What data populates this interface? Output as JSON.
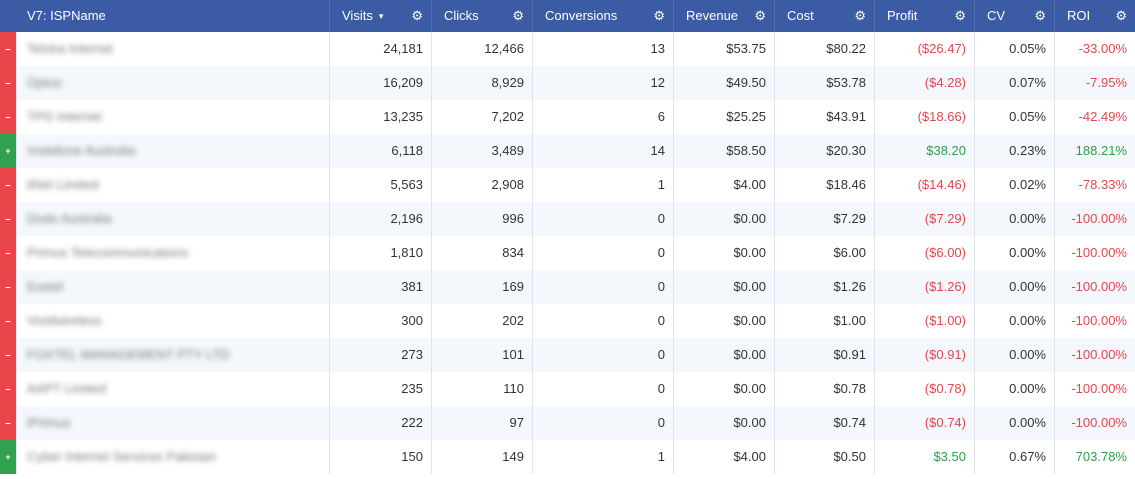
{
  "colors": {
    "header_bg": "#3b5ba5",
    "negative": "#e0484c",
    "positive": "#2e9e48",
    "indicator_minus": "#e9464b",
    "indicator_plus": "#2fa14f"
  },
  "header": {
    "name": "V7: ISPName",
    "visits": "Visits",
    "visits_sort": "▾",
    "clicks": "Clicks",
    "conversions": "Conversions",
    "revenue": "Revenue",
    "cost": "Cost",
    "profit": "Profit",
    "cv": "CV",
    "roi": "ROI",
    "gear": "⚙"
  },
  "rows": [
    {
      "ind": "–",
      "ind_type": "minus",
      "name": "Telstra Internet",
      "visits": "24,181",
      "clicks": "12,466",
      "conversions": "13",
      "revenue": "$53.75",
      "cost": "$80.22",
      "profit": "($26.47)",
      "cv": "0.05%",
      "roi": "-33.00%",
      "tone": "neg"
    },
    {
      "ind": "–",
      "ind_type": "minus",
      "name": "Optus",
      "visits": "16,209",
      "clicks": "8,929",
      "conversions": "12",
      "revenue": "$49.50",
      "cost": "$53.78",
      "profit": "($4.28)",
      "cv": "0.07%",
      "roi": "-7.95%",
      "tone": "neg"
    },
    {
      "ind": "–",
      "ind_type": "minus",
      "name": "TPG Internet",
      "visits": "13,235",
      "clicks": "7,202",
      "conversions": "6",
      "revenue": "$25.25",
      "cost": "$43.91",
      "profit": "($18.66)",
      "cv": "0.05%",
      "roi": "-42.49%",
      "tone": "neg"
    },
    {
      "ind": "+",
      "ind_type": "plus",
      "name": "Vodafone Australia",
      "visits": "6,118",
      "clicks": "3,489",
      "conversions": "14",
      "revenue": "$58.50",
      "cost": "$20.30",
      "profit": "$38.20",
      "cv": "0.23%",
      "roi": "188.21%",
      "tone": "pos"
    },
    {
      "ind": "–",
      "ind_type": "minus",
      "name": "iiNet Limited",
      "visits": "5,563",
      "clicks": "2,908",
      "conversions": "1",
      "revenue": "$4.00",
      "cost": "$18.46",
      "profit": "($14.46)",
      "cv": "0.02%",
      "roi": "-78.33%",
      "tone": "neg"
    },
    {
      "ind": "–",
      "ind_type": "minus",
      "name": "Dodo Australia",
      "visits": "2,196",
      "clicks": "996",
      "conversions": "0",
      "revenue": "$0.00",
      "cost": "$7.29",
      "profit": "($7.29)",
      "cv": "0.00%",
      "roi": "-100.00%",
      "tone": "neg"
    },
    {
      "ind": "–",
      "ind_type": "minus",
      "name": "Primus Telecommunications",
      "visits": "1,810",
      "clicks": "834",
      "conversions": "0",
      "revenue": "$0.00",
      "cost": "$6.00",
      "profit": "($6.00)",
      "cv": "0.00%",
      "roi": "-100.00%",
      "tone": "neg"
    },
    {
      "ind": "–",
      "ind_type": "minus",
      "name": "Exetel",
      "visits": "381",
      "clicks": "169",
      "conversions": "0",
      "revenue": "$0.00",
      "cost": "$1.26",
      "profit": "($1.26)",
      "cv": "0.00%",
      "roi": "-100.00%",
      "tone": "neg"
    },
    {
      "ind": "–",
      "ind_type": "minus",
      "name": "Vividwireless",
      "visits": "300",
      "clicks": "202",
      "conversions": "0",
      "revenue": "$0.00",
      "cost": "$1.00",
      "profit": "($1.00)",
      "cv": "0.00%",
      "roi": "-100.00%",
      "tone": "neg"
    },
    {
      "ind": "–",
      "ind_type": "minus",
      "name": "FOXTEL MANAGEMENT PTY LTD",
      "visits": "273",
      "clicks": "101",
      "conversions": "0",
      "revenue": "$0.00",
      "cost": "$0.91",
      "profit": "($0.91)",
      "cv": "0.00%",
      "roi": "-100.00%",
      "tone": "neg"
    },
    {
      "ind": "–",
      "ind_type": "minus",
      "name": "AAPT Limited",
      "visits": "235",
      "clicks": "110",
      "conversions": "0",
      "revenue": "$0.00",
      "cost": "$0.78",
      "profit": "($0.78)",
      "cv": "0.00%",
      "roi": "-100.00%",
      "tone": "neg"
    },
    {
      "ind": "–",
      "ind_type": "minus",
      "name": "iPrimus",
      "visits": "222",
      "clicks": "97",
      "conversions": "0",
      "revenue": "$0.00",
      "cost": "$0.74",
      "profit": "($0.74)",
      "cv": "0.00%",
      "roi": "-100.00%",
      "tone": "neg"
    },
    {
      "ind": "+",
      "ind_type": "plus",
      "name": "Cyber Internet Services Pakistan",
      "visits": "150",
      "clicks": "149",
      "conversions": "1",
      "revenue": "$4.00",
      "cost": "$0.50",
      "profit": "$3.50",
      "cv": "0.67%",
      "roi": "703.78%",
      "tone": "pos"
    }
  ]
}
